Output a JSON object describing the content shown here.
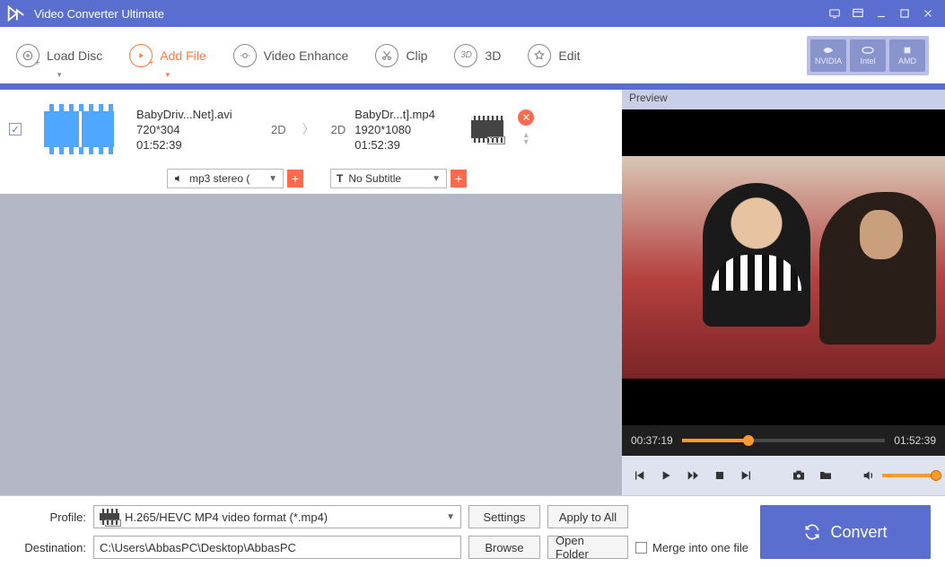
{
  "app": {
    "title": "Video Converter Ultimate"
  },
  "toolbar": {
    "load_disc": "Load Disc",
    "add_file": "Add File",
    "video_enhance": "Video Enhance",
    "clip": "Clip",
    "three_d": "3D",
    "edit": "Edit"
  },
  "gpu": {
    "nvidia": "NVIDIA",
    "intel": "Intel",
    "amd": "AMD"
  },
  "item": {
    "src_name": "BabyDriv...Net].avi",
    "src_res": "720*304",
    "src_dur": "01:52:39",
    "src_mode": "2D",
    "dst_mode": "2D",
    "dst_name": "BabyDr...t].mp4",
    "dst_res": "1920*1080",
    "dst_dur": "01:52:39",
    "dst_fmt_tag": "MP4",
    "audio_sel": "mp3 stereo (",
    "sub_sel": "No Subtitle"
  },
  "preview": {
    "header": "Preview",
    "pos": "00:37:19",
    "dur": "01:52:39"
  },
  "footer": {
    "profile_label": "Profile:",
    "profile_value": "H.265/HEVC MP4 video format (*.mp4)",
    "settings": "Settings",
    "apply_all": "Apply to All",
    "dest_label": "Destination:",
    "dest_value": "C:\\Users\\AbbasPC\\Desktop\\AbbasPC",
    "browse": "Browse",
    "open_folder": "Open Folder",
    "merge": "Merge into one file",
    "convert": "Convert"
  }
}
